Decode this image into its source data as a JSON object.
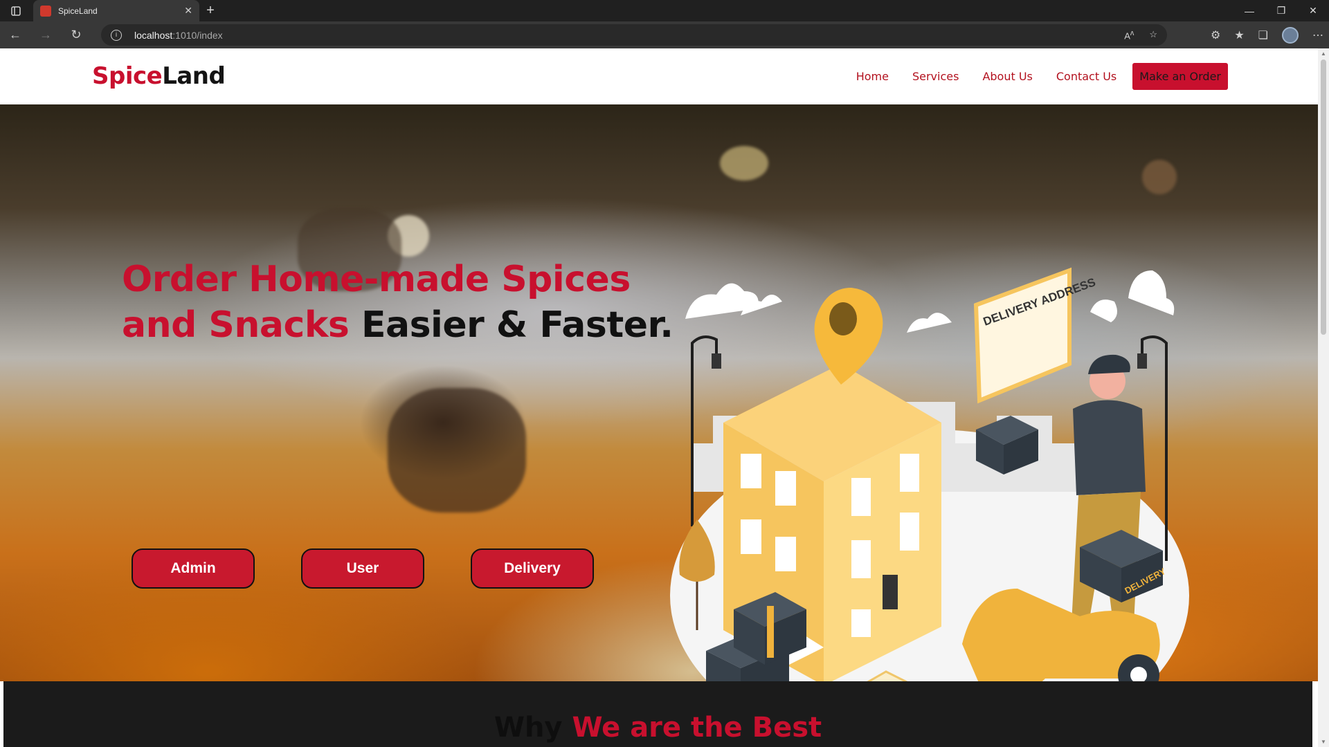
{
  "browser": {
    "tab_title": "SpiceLand",
    "url_host": "localhost",
    "url_path": ":1010/index"
  },
  "site": {
    "logo_part1": "Spice",
    "logo_part2": "Land",
    "nav": [
      "Home",
      "Services",
      "About Us",
      "Contact Us"
    ],
    "cta": "Make an Order"
  },
  "hero": {
    "title_red_1": "Order Home-made Spices",
    "title_red_2": "and Snacks",
    "title_dark": "Easier & Faster.",
    "buttons": [
      "Admin",
      "User",
      "Delivery"
    ],
    "illustration_labels": {
      "sign": "DELIVERY ADDRESS",
      "box": "DELIVERY"
    }
  },
  "section2": {
    "heading_dark": "Why",
    "heading_red": "We are the Best"
  },
  "colors": {
    "brand_red": "#c8102e",
    "dark": "#111111"
  }
}
